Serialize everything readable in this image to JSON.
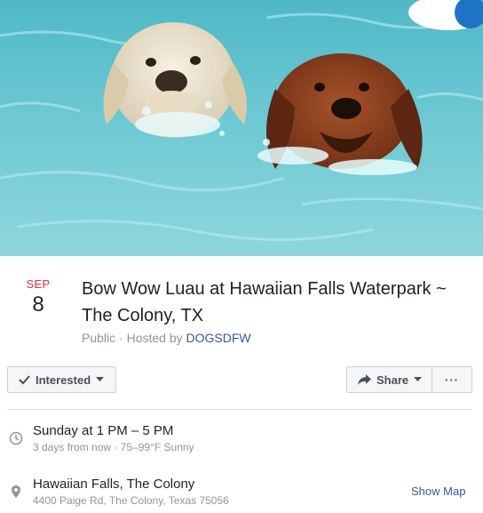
{
  "cover": {
    "alt_icon": "cover-photo",
    "subject": "two dogs swimming in pool"
  },
  "event": {
    "date_month": "SEP",
    "date_day": "8",
    "title": "Bow Wow Luau at Hawaiian Falls Waterpark ~ The Colony, TX",
    "public_label": "Public",
    "separator": " · ",
    "hosted_prefix": "Hosted by ",
    "host": "DOGSDFW"
  },
  "actions": {
    "interested_label": "Interested",
    "share_label": "Share",
    "more_label": "···"
  },
  "when": {
    "main": "Sunday at 1 PM – 5 PM",
    "sub": "3 days from now · 75–99°F Sunny"
  },
  "where": {
    "main": "Hawaiian Falls, The Colony",
    "sub": "4400 Paige Rd, The Colony, Texas 75056",
    "map_link": "Show Map"
  },
  "colors": {
    "month": "#f02849",
    "link": "#365899",
    "muted": "#90949c",
    "text": "#1d2129",
    "water": "#5fc3cf"
  }
}
